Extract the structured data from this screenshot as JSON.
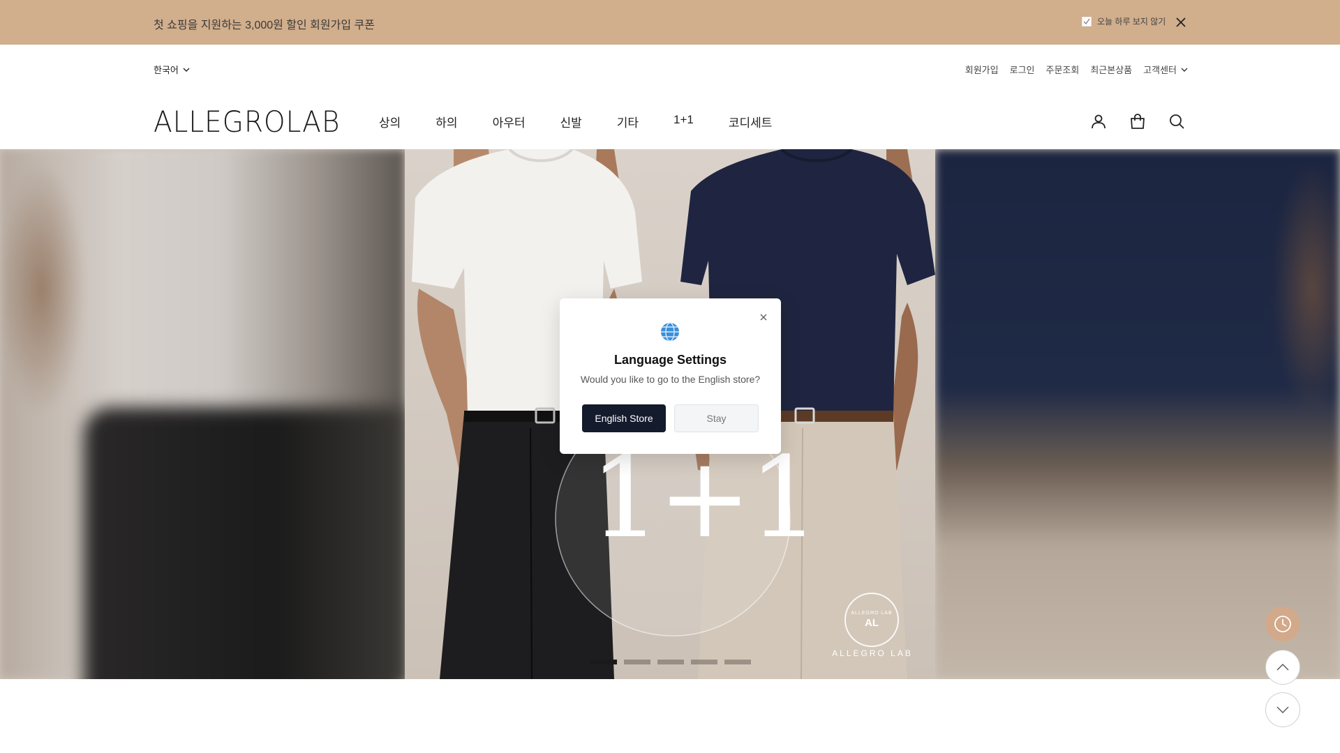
{
  "promo": {
    "text": "첫 쇼핑을 지원하는 3,000원 할인 회원가입 쿠폰",
    "hide_today_label": "오늘 하루 보지 않기",
    "hide_today_checked": true,
    "close_icon": "close-icon"
  },
  "utility": {
    "language": "한국어",
    "links": [
      "회원가입",
      "로그인",
      "주문조회",
      "최근본상품",
      "고객센터"
    ]
  },
  "header": {
    "logo": "ALLEGROLAB",
    "nav": [
      "상의",
      "하의",
      "아우터",
      "신발",
      "기타",
      "1+1",
      "코디세트"
    ],
    "icons": [
      "user-icon",
      "bag-icon",
      "search-icon"
    ]
  },
  "hero": {
    "headline": "1+1",
    "brand_mark_small": "ALLEGRO LAB",
    "brand_mark_big": "AL",
    "brand_name": "ALLEGRO LAB",
    "slide_count": 5,
    "active_slide": 1
  },
  "modal": {
    "icon": "globe-icon",
    "title": "Language Settings",
    "message": "Would you like to go to the English store?",
    "primary_button": "English Store",
    "secondary_button": "Stay"
  },
  "floating": {
    "history_icon": "clock-icon",
    "up_icon": "chevron-up-icon",
    "down_icon": "chevron-down-icon"
  },
  "colors": {
    "promo_bg": "#d1ae8c",
    "primary_button": "#141b2d",
    "history_button": "#d2a98a"
  }
}
